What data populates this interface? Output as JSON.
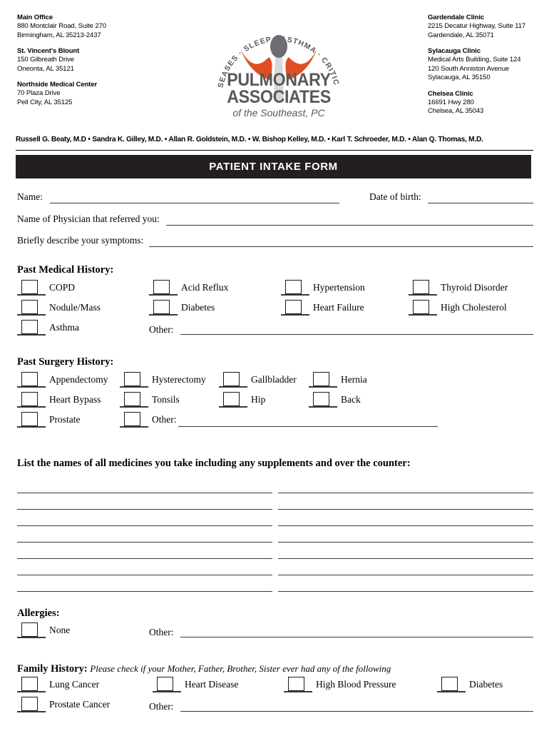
{
  "header": {
    "left_addresses": [
      {
        "name": "Main Office",
        "lines": [
          "880 Montclair Road, Suite 270",
          "Birmingham, AL 35213-2437"
        ]
      },
      {
        "name": "St. Vincent's Blount",
        "lines": [
          "150 Gilbreath Drive",
          "Oneonta, AL 35121"
        ]
      },
      {
        "name": "Northside Medical Center",
        "lines": [
          "70 Plaza Drive",
          "Pell City, AL 35125"
        ]
      }
    ],
    "right_addresses": [
      {
        "name": "Gardendale Clinic",
        "lines": [
          "2215 Decatur Highway, Suite 117",
          "Gardendale, AL 35071"
        ]
      },
      {
        "name": "Sylacauga Clinic",
        "lines": [
          "Medical Arts Building, Suite 124",
          "120 South Anniston Avenue",
          "Sylacauga, AL 35150"
        ]
      },
      {
        "name": "Chelsea Clinic",
        "lines": [
          "16691 Hwy 280",
          "Chelsea, AL 35043"
        ]
      }
    ],
    "logo": {
      "arc_text": "LUNG DISEASES · SLEEP · ASTHMA · CRITICAL CARE",
      "line1": "PULMONARY",
      "line2": "ASSOCIATES",
      "tagline": "of the Southeast, PC",
      "wing_color": "#e04e23",
      "text_color": "#58595b",
      "body_color": "#d8d8d8",
      "head_color": "#6d6e71"
    },
    "doctors": "Russell G. Beaty, M.D • Sandra K. Gilley, M.D. •  Allan R. Goldstein, M.D.  •  W. Bishop Kelley, M.D. • Karl T. Schroeder, M.D. •  Alan Q. Thomas, M.D."
  },
  "title_bar": {
    "label": "PATIENT INTAKE FORM",
    "background": "#231f20",
    "text_color": "#ffffff"
  },
  "fields": {
    "name_label": "Name:",
    "dob_label": "Date of birth:",
    "referring_label": "Name of Physician that referred you:",
    "symptoms_label": "Briefly describe your symptoms:",
    "name_value": "",
    "dob_value": "",
    "referring_value": "",
    "symptoms_value": ""
  },
  "medical_history": {
    "heading": "Past Medical History:",
    "items": [
      {
        "label": "COPD",
        "checked": false
      },
      {
        "label": "Acid Reflux",
        "checked": false
      },
      {
        "label": "Hypertension",
        "checked": false
      },
      {
        "label": "Thyroid Disorder",
        "checked": false
      },
      {
        "label": "Nodule/Mass",
        "checked": false
      },
      {
        "label": "Diabetes",
        "checked": false
      },
      {
        "label": "Heart Failure",
        "checked": false
      },
      {
        "label": "High Cholesterol",
        "checked": false
      },
      {
        "label": "Asthma",
        "checked": false
      }
    ],
    "other_label": "Other:",
    "other_value": ""
  },
  "surgery_history": {
    "heading": "Past Surgery History:",
    "items": [
      {
        "label": "Appendectomy",
        "checked": false
      },
      {
        "label": "Hysterectomy",
        "checked": false
      },
      {
        "label": "Gallbladder",
        "checked": false
      },
      {
        "label": "Hernia",
        "checked": false
      },
      {
        "label": "Heart Bypass",
        "checked": false
      },
      {
        "label": "Tonsils",
        "checked": false
      },
      {
        "label": "Hip",
        "checked": false
      },
      {
        "label": "Back",
        "checked": false
      },
      {
        "label": "Prostate",
        "checked": false
      }
    ],
    "other_label": "Other:",
    "other_value": ""
  },
  "medicines": {
    "heading": "List the names of all medicines you take including any supplements and over the counter:",
    "rows": 7,
    "left_values": [
      "",
      "",
      "",
      "",
      "",
      "",
      ""
    ],
    "right_values": [
      "",
      "",
      "",
      "",
      "",
      "",
      ""
    ]
  },
  "allergies": {
    "heading": "Allergies:",
    "none_label": "None",
    "none_checked": false,
    "other_label": "Other:",
    "other_value": ""
  },
  "family_history": {
    "heading": "Family History:",
    "subtitle": "Please check if your Mother, Father, Brother, Sister ever had any of the following",
    "items": [
      {
        "label": "Lung Cancer",
        "checked": false
      },
      {
        "label": "Heart Disease",
        "checked": false
      },
      {
        "label": "High Blood Pressure",
        "checked": false
      },
      {
        "label": "Diabetes",
        "checked": false
      },
      {
        "label": "Prostate Cancer",
        "checked": false
      }
    ],
    "other_label": "Other:",
    "other_value": ""
  }
}
